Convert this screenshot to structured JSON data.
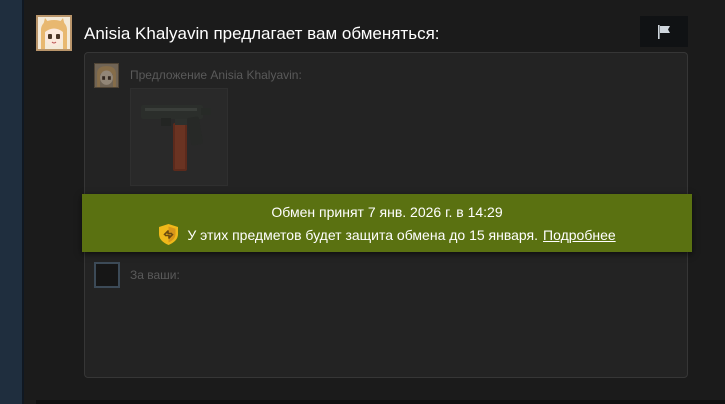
{
  "header": {
    "title": "Anisia Khalyavin предлагает вам обменяться:",
    "avatar_icon": "anime-girl-avatar-icon",
    "report_icon": "flag-icon"
  },
  "offer": {
    "label": "Предложение Anisia Khalyavin:",
    "item_icon": "pistol-weapon-icon"
  },
  "banner": {
    "accepted_text": "Обмен принят 7 янв. 2026 г. в 14:29",
    "protection_text": "У этих предметов будет защита обмена до 15 января.",
    "more_link": "Подробнее",
    "shield_icon": "shield-icon",
    "color": "#5a7111"
  },
  "yours": {
    "label": "За ваши:"
  }
}
